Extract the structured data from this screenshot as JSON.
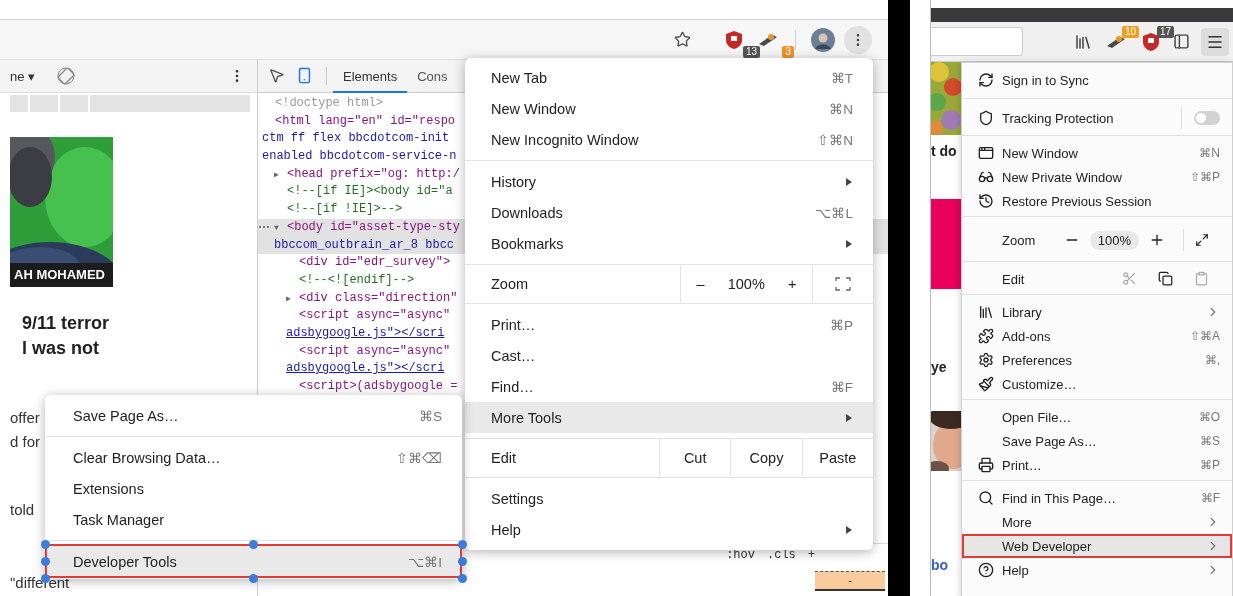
{
  "chrome": {
    "toolbar": {
      "extension_badges": [
        "13",
        "3"
      ]
    },
    "device_toolbar": {
      "device": "ne ▾"
    },
    "page": {
      "photo_caption": "AH MOHAMED",
      "headline": [
        "9/11 terror",
        "l was not"
      ],
      "fragments": [
        "offer",
        "d for",
        "told",
        "\"different"
      ]
    },
    "devtools": {
      "tabs": [
        {
          "label": "Elements",
          "selected": true
        },
        {
          "label": "Cons",
          "selected": false
        }
      ],
      "dom_tree": [
        {
          "lines": [
            {
              "text": "<!doctype html>",
              "kind": "doctype"
            }
          ],
          "selected": false
        },
        {
          "lines": [
            {
              "text": "<html lang=\"en\" id=\"respo",
              "kind": "tag"
            },
            {
              "text": "ctm ff flex bbcdotcom-init",
              "kind": "value"
            },
            {
              "text": "enabled bbcdotcom-service-n",
              "kind": "value"
            }
          ],
          "selected": false,
          "children": [
            {
              "toggle": "▶",
              "lines": [
                {
                  "text": "<head prefix=\"og: http:/",
                  "kind": "tag"
                }
              ],
              "selected": false
            },
            {
              "lines": [
                {
                  "text": "<!--[if IE]><body id=\"a",
                  "kind": "comment"
                }
              ],
              "selected": false
            },
            {
              "lines": [
                {
                  "text": "<!--[if !IE]>-->",
                  "kind": "comment"
                }
              ],
              "selected": false
            },
            {
              "toggle": "▼",
              "lines": [
                {
                  "text": "<body id=\"asset-type-sty",
                  "kind": "tag"
                },
                {
                  "text": "bbccom_outbrain_ar_8 bbcc",
                  "kind": "value"
                }
              ],
              "selected": true,
              "children": [
                {
                  "lines": [
                    {
                      "text": "<div id=\"edr_survey\">",
                      "kind": "tag"
                    }
                  ],
                  "selected": false
                },
                {
                  "lines": [
                    {
                      "text": "<!--<![endif]-->",
                      "kind": "comment"
                    }
                  ],
                  "selected": false
                },
                {
                  "toggle": "▶",
                  "lines": [
                    {
                      "text": "<div class=\"direction\"",
                      "kind": "tag"
                    }
                  ],
                  "selected": false
                },
                {
                  "lines": [
                    {
                      "text": "<script async=\"async\"",
                      "kind": "tag"
                    },
                    {
                      "text": "adsbygoogle.js\"></scri",
                      "kind": "link"
                    }
                  ],
                  "selected": false
                },
                {
                  "lines": [
                    {
                      "text": "<script async=\"async\"",
                      "kind": "tag"
                    },
                    {
                      "text": "adsbygoogle.js\"></scri",
                      "kind": "link"
                    }
                  ],
                  "selected": false
                },
                {
                  "lines": [
                    {
                      "text": "<script>(adsbygoogle =",
                      "kind": "tag"
                    }
                  ],
                  "selected": false
                }
              ]
            }
          ]
        }
      ],
      "styles_toolbar": [
        ":hov",
        ".cls",
        "+"
      ],
      "box_model_value": "-"
    },
    "menu": {
      "items": [
        {
          "kind": "item",
          "label": "New Tab",
          "shortcut": "⌘T",
          "submenu": false,
          "selected": false
        },
        {
          "kind": "item",
          "label": "New Window",
          "shortcut": "⌘N",
          "submenu": false,
          "selected": false
        },
        {
          "kind": "item",
          "label": "New Incognito Window",
          "shortcut": "⇧⌘N",
          "submenu": false,
          "selected": false
        },
        {
          "kind": "separator"
        },
        {
          "kind": "item",
          "label": "History",
          "submenu": true,
          "selected": false
        },
        {
          "kind": "item",
          "label": "Downloads",
          "shortcut": "⌥⌘L",
          "submenu": false,
          "selected": false
        },
        {
          "kind": "item",
          "label": "Bookmarks",
          "submenu": true,
          "selected": false
        },
        {
          "kind": "separator"
        },
        {
          "kind": "zoom",
          "label": "Zoom",
          "minus": "–",
          "value": "100%",
          "plus": "+"
        },
        {
          "kind": "separator"
        },
        {
          "kind": "item",
          "label": "Print…",
          "shortcut": "⌘P",
          "submenu": false,
          "selected": false
        },
        {
          "kind": "item",
          "label": "Cast…",
          "submenu": false,
          "selected": false
        },
        {
          "kind": "item",
          "label": "Find…",
          "shortcut": "⌘F",
          "submenu": false,
          "selected": false
        },
        {
          "kind": "item",
          "label": "More Tools",
          "submenu": true,
          "selected": true
        },
        {
          "kind": "separator"
        },
        {
          "kind": "edit",
          "label": "Edit",
          "actions": [
            "Cut",
            "Copy",
            "Paste"
          ]
        },
        {
          "kind": "separator"
        },
        {
          "kind": "item",
          "label": "Settings",
          "submenu": false,
          "selected": false
        },
        {
          "kind": "item",
          "label": "Help",
          "submenu": true,
          "selected": false
        }
      ]
    },
    "more_tools_submenu": {
      "items": [
        {
          "kind": "item",
          "label": "Save Page As…",
          "shortcut": "⌘S",
          "selected": false,
          "outlined": false
        },
        {
          "kind": "separator"
        },
        {
          "kind": "item",
          "label": "Clear Browsing Data…",
          "shortcut": "⇧⌘⌫",
          "selected": false,
          "outlined": false
        },
        {
          "kind": "item",
          "label": "Extensions",
          "selected": false,
          "outlined": false
        },
        {
          "kind": "item",
          "label": "Task Manager",
          "selected": false,
          "outlined": false
        },
        {
          "kind": "separator"
        },
        {
          "kind": "item",
          "label": "Developer Tools",
          "shortcut": "⌥⌘I",
          "selected": true,
          "outlined": true
        }
      ]
    }
  },
  "firefox": {
    "toolbar": {
      "extension_badges": [
        "10",
        "17"
      ]
    },
    "page": {
      "fragments": [
        "t do",
        "ye",
        "bo"
      ]
    },
    "menu": {
      "items": [
        {
          "kind": "item",
          "label": "Sign in to Sync",
          "submenu": false,
          "selected": false,
          "outlined": false
        },
        {
          "kind": "separator"
        },
        {
          "kind": "toggle",
          "label": "Tracking Protection",
          "on": false
        },
        {
          "kind": "separator"
        },
        {
          "kind": "item",
          "label": "New Window",
          "shortcut": "⌘N",
          "submenu": false,
          "selected": false,
          "outlined": false
        },
        {
          "kind": "item",
          "label": "New Private Window",
          "shortcut": "⇧⌘P",
          "submenu": false,
          "selected": false,
          "outlined": false
        },
        {
          "kind": "item",
          "label": "Restore Previous Session",
          "submenu": false,
          "selected": false,
          "outlined": false
        },
        {
          "kind": "separator"
        },
        {
          "kind": "zoom",
          "label": "Zoom",
          "value": "100%"
        },
        {
          "kind": "separator"
        },
        {
          "kind": "edit",
          "label": "Edit",
          "actions": [
            {
              "disabled": true
            },
            {
              "disabled": false
            },
            {
              "disabled": true
            }
          ]
        },
        {
          "kind": "separator"
        },
        {
          "kind": "item",
          "label": "Library",
          "submenu": true,
          "selected": false,
          "outlined": false
        },
        {
          "kind": "item",
          "label": "Add-ons",
          "shortcut": "⇧⌘A",
          "submenu": false,
          "selected": false,
          "outlined": false
        },
        {
          "kind": "item",
          "label": "Preferences",
          "shortcut": "⌘,",
          "submenu": false,
          "selected": false,
          "outlined": false
        },
        {
          "kind": "item",
          "label": "Customize…",
          "submenu": false,
          "selected": false,
          "outlined": false
        },
        {
          "kind": "separator"
        },
        {
          "kind": "item",
          "label": "Open File…",
          "shortcut": "⌘O",
          "submenu": false,
          "selected": false,
          "outlined": false
        },
        {
          "kind": "item",
          "label": "Save Page As…",
          "shortcut": "⌘S",
          "submenu": false,
          "selected": false,
          "outlined": false
        },
        {
          "kind": "item",
          "label": "Print…",
          "shortcut": "⌘P",
          "submenu": false,
          "selected": false,
          "outlined": false
        },
        {
          "kind": "separator"
        },
        {
          "kind": "item",
          "label": "Find in This Page…",
          "shortcut": "⌘F",
          "submenu": false,
          "selected": false,
          "outlined": false
        },
        {
          "kind": "item",
          "label": "More",
          "submenu": true,
          "selected": false,
          "outlined": false
        },
        {
          "kind": "item",
          "label": "Web Developer",
          "submenu": true,
          "selected": true,
          "outlined": true
        },
        {
          "kind": "item",
          "label": "Help",
          "submenu": true,
          "selected": false,
          "outlined": false
        }
      ]
    }
  }
}
